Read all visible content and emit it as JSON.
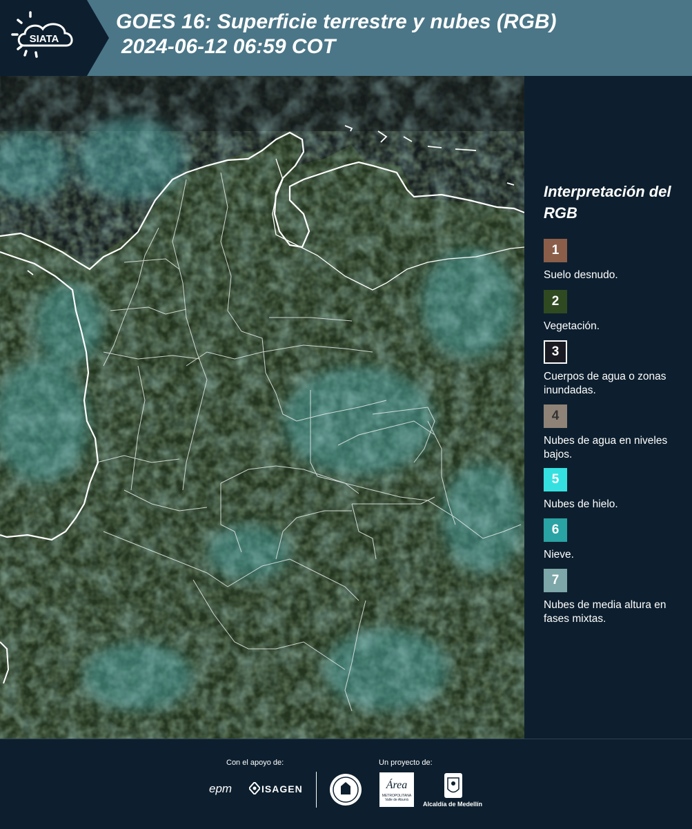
{
  "header": {
    "brand": "SIATA",
    "title_line1": "GOES 16: Superficie terrestre y nubes (RGB)",
    "title_line2": "2024-06-12 06:59 COT",
    "background_color": "#4b7687"
  },
  "legend": {
    "title": "Interpretación del RGB",
    "items": [
      {
        "number": "1",
        "label": "Suelo desnudo.",
        "color": "#8b5e4a"
      },
      {
        "number": "2",
        "label": "Vegetación.",
        "color": "#2f4a21"
      },
      {
        "number": "3",
        "label": "Cuerpos de agua o zonas inundadas.",
        "color": "#1a1a22"
      },
      {
        "number": "4",
        "label": "Nubes de agua en niveles bajos.",
        "color": "#8f8377"
      },
      {
        "number": "5",
        "label": "Nubes de hielo.",
        "color": "#35e1e0"
      },
      {
        "number": "6",
        "label": "Nieve.",
        "color": "#2aa3a4"
      },
      {
        "number": "7",
        "label": "Nubes de media altura en fases mixtas.",
        "color": "#7da7a8"
      }
    ]
  },
  "footer": {
    "support_caption": "Con el apoyo de:",
    "project_caption": "Un proyecto de:",
    "sponsors": [
      "epm",
      "ISAGEN"
    ],
    "partners": {
      "metro_name": "Área",
      "metro_line1": "METROPOLITANA",
      "metro_line2": "Valle de Aburrá",
      "alcaldia": "Alcaldía de Medellín"
    }
  },
  "map": {
    "ocean_color": "#161e1f",
    "land_color": "#253a24",
    "cloud_color": "#4fa7a6",
    "border_color": "#ffffff"
  }
}
